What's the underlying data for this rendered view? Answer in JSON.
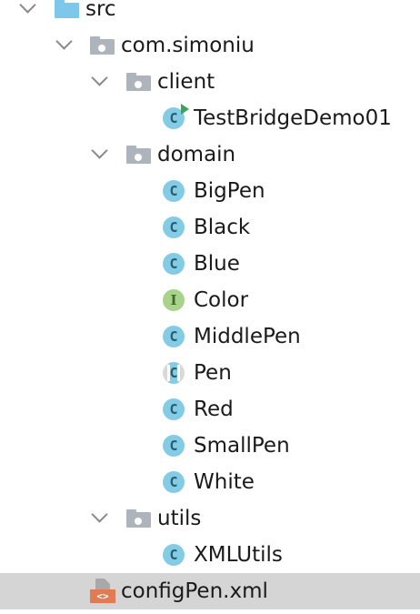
{
  "tree": {
    "src": {
      "label": "src"
    },
    "pkg_root": {
      "label": "com.simoniu"
    },
    "pkg_client": {
      "label": "client"
    },
    "test_class": {
      "label": "TestBridgeDemo01",
      "icon": "class-runnable-icon"
    },
    "pkg_domain": {
      "label": "domain"
    },
    "domain_items": [
      {
        "label": "BigPen",
        "kind": "class"
      },
      {
        "label": "Black",
        "kind": "class"
      },
      {
        "label": "Blue",
        "kind": "class"
      },
      {
        "label": "Color",
        "kind": "interface"
      },
      {
        "label": "MiddlePen",
        "kind": "class"
      },
      {
        "label": "Pen",
        "kind": "abstract-class"
      },
      {
        "label": "Red",
        "kind": "class"
      },
      {
        "label": "SmallPen",
        "kind": "class"
      },
      {
        "label": "White",
        "kind": "class"
      }
    ],
    "pkg_utils": {
      "label": "utils"
    },
    "utils_class": {
      "label": "XMLUtils"
    },
    "config_file": {
      "label": "configPen.xml",
      "selected": true
    }
  },
  "icons": {
    "class_glyph": "C",
    "interface_glyph": "I",
    "xml_glyph": "<>"
  },
  "colors": {
    "class_icon": "#84cbe6",
    "interface_icon": "#a7d38a",
    "source_folder": "#7dc7ea",
    "package_folder": "#aeb4bb",
    "selection": "#d5d5d5",
    "xml_tag": "#e07b53"
  }
}
